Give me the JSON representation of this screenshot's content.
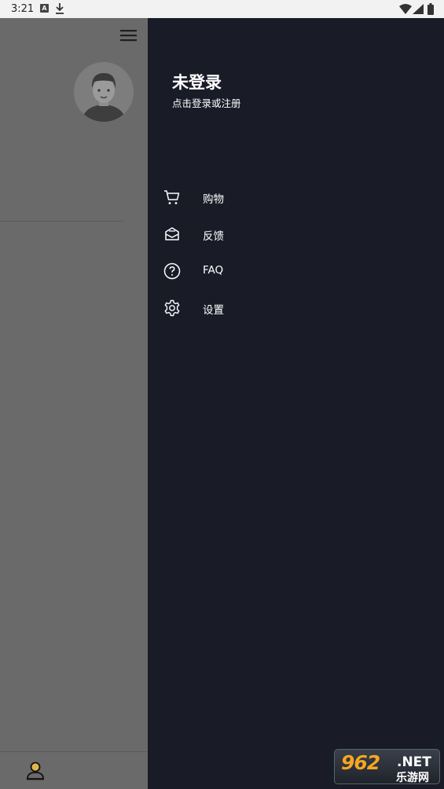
{
  "status_bar": {
    "time": "3:21",
    "notification_icon": "A",
    "icons": [
      "download-icon",
      "wifi-icon",
      "signal-icon",
      "battery-icon"
    ]
  },
  "main": {
    "menu_icon": "hamburger-icon",
    "avatar_icon": "avatar-man-icon",
    "bottom_nav_icon": "user-icon"
  },
  "drawer": {
    "title": "未登录",
    "subtitle": "点击登录或注册",
    "items": [
      {
        "label": "购物",
        "icon": "cart-icon"
      },
      {
        "label": "反馈",
        "icon": "mail-feedback-icon"
      },
      {
        "label": "FAQ",
        "icon": "help-circle-icon"
      },
      {
        "label": "设置",
        "icon": "gear-icon"
      }
    ]
  },
  "watermark": {
    "main": "962",
    "suffix": ".NET",
    "sub": "乐游网"
  },
  "colors": {
    "drawer_bg": "#191b27",
    "scrim": "#6a6a6a",
    "accent_user": "#e0b64a"
  }
}
